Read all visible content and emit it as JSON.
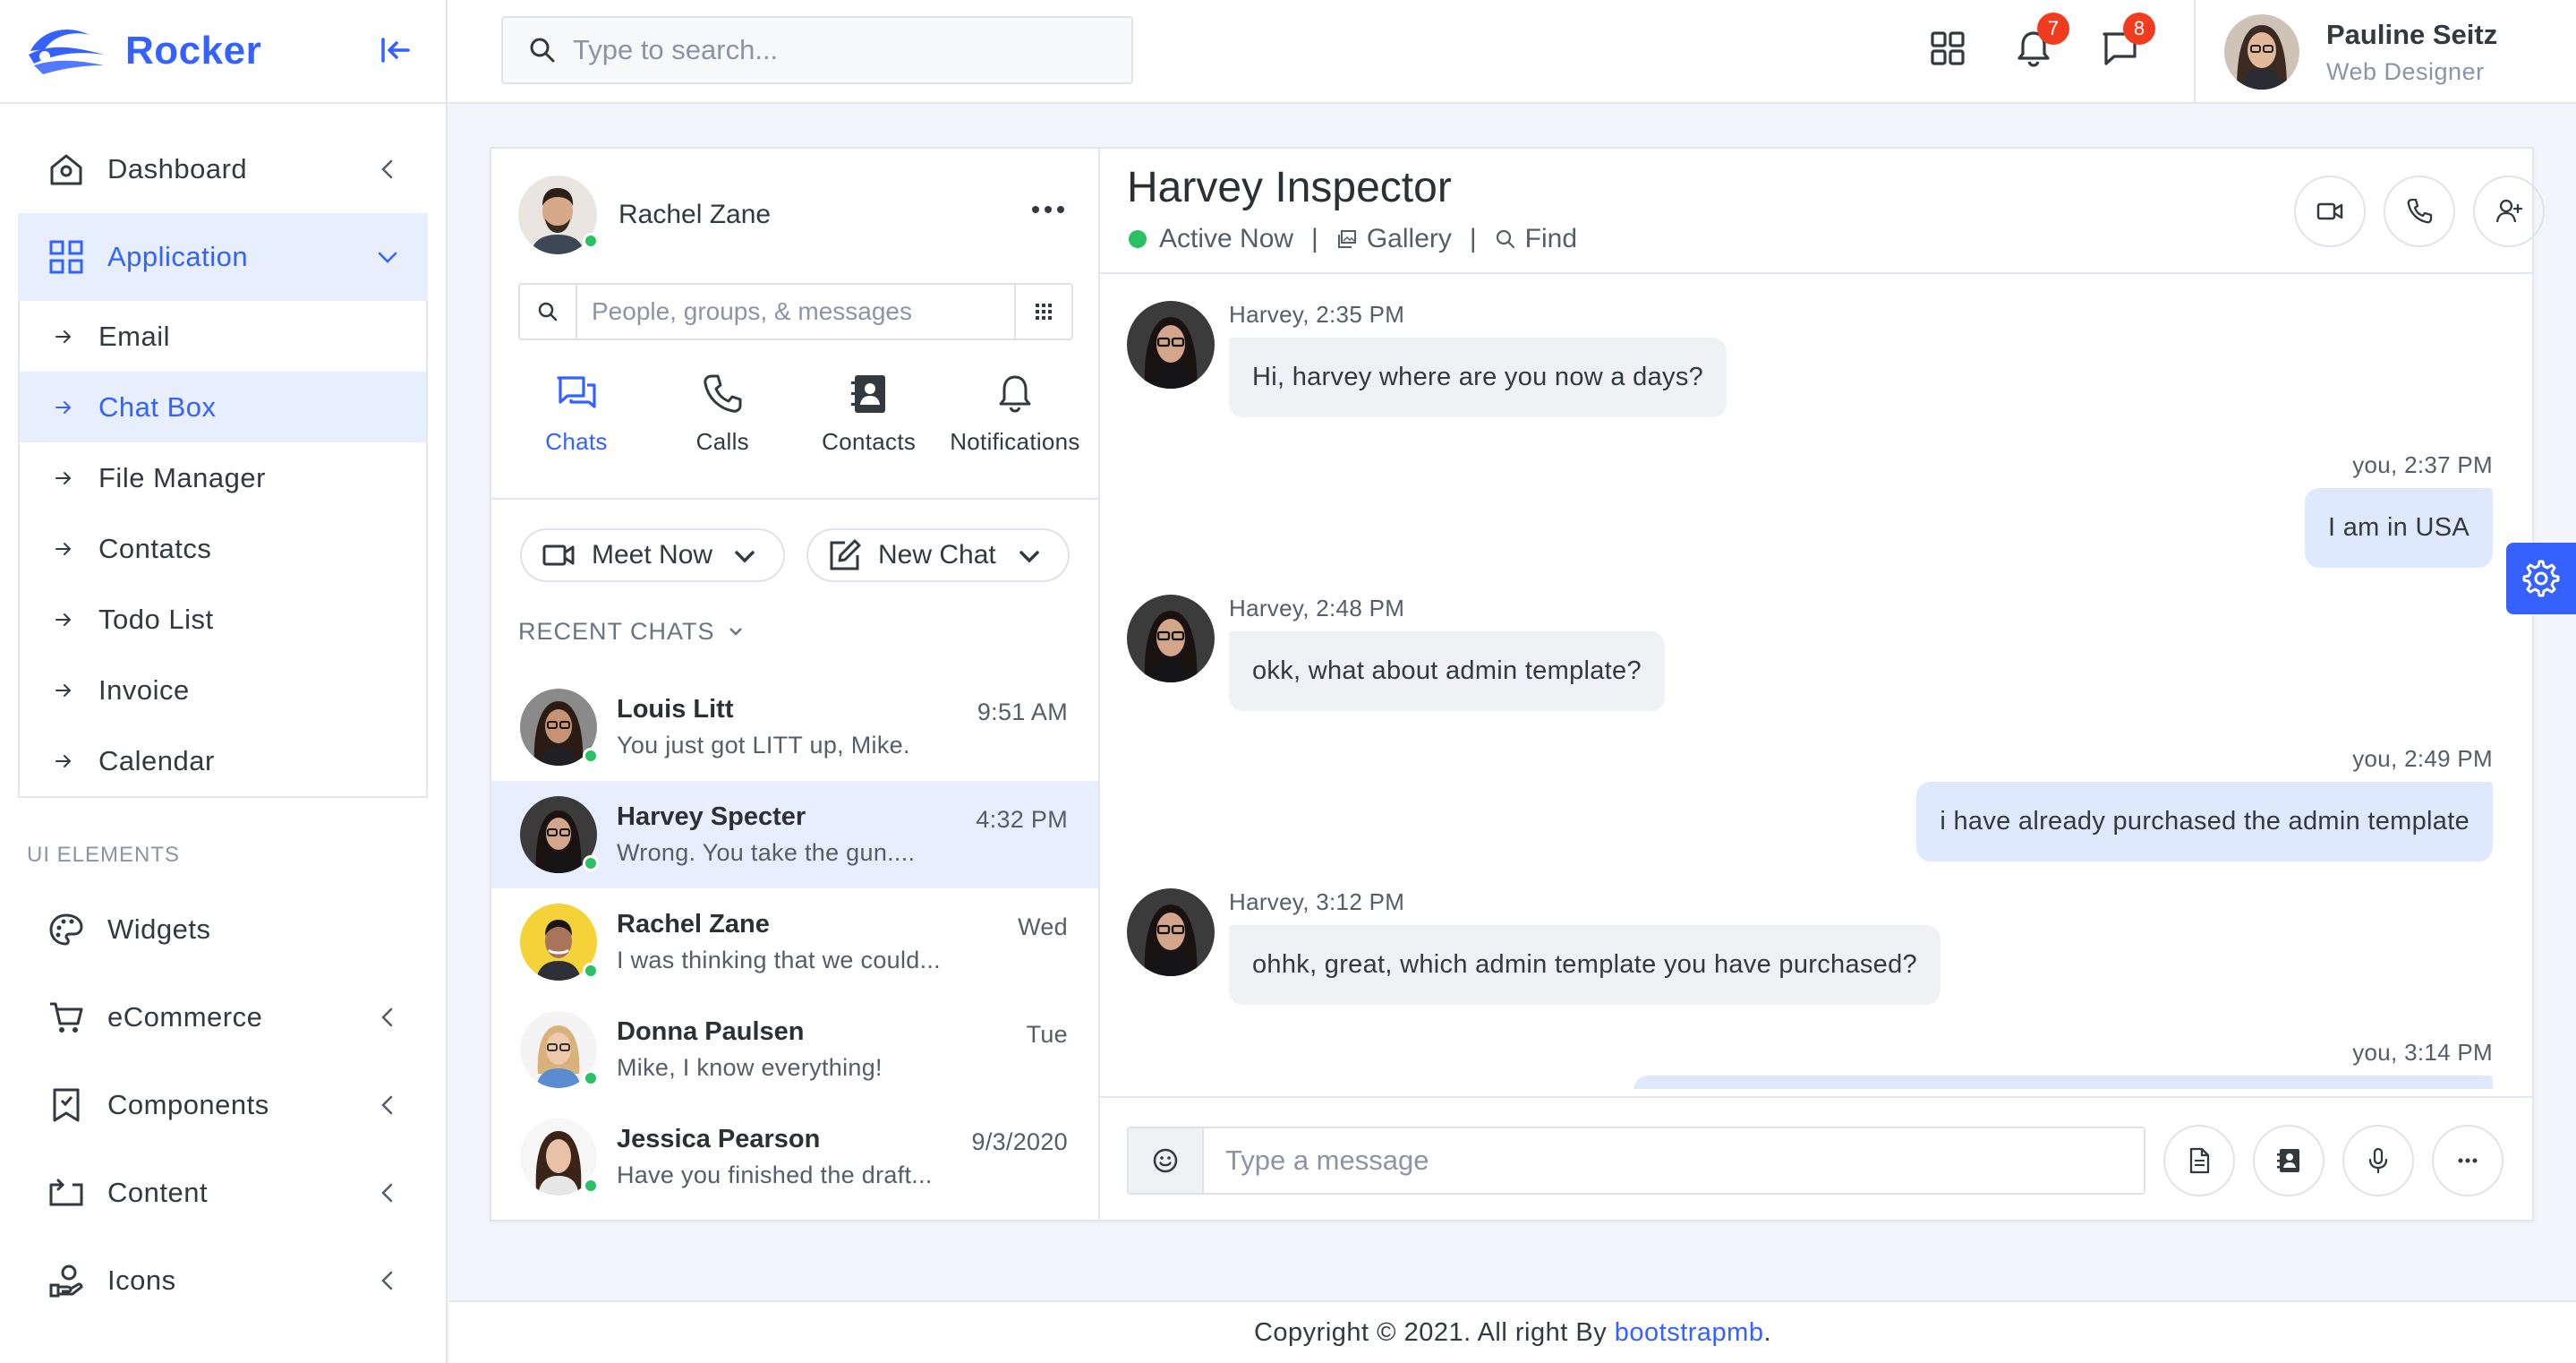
{
  "brand": {
    "name": "Rocker",
    "accent": "#3461ff"
  },
  "sidebar": {
    "items": [
      {
        "label": "Dashboard",
        "icon": "home-icon"
      },
      {
        "label": "Application",
        "icon": "grid-icon",
        "expanded": true
      },
      {
        "label": "Widgets",
        "icon": "palette-icon"
      },
      {
        "label": "eCommerce",
        "icon": "cart-icon"
      },
      {
        "label": "Components",
        "icon": "bookmark-icon"
      },
      {
        "label": "Content",
        "icon": "repeat-icon"
      },
      {
        "label": "Icons",
        "icon": "hand-icon"
      }
    ],
    "submenu": [
      "Email",
      "Chat Box",
      "File Manager",
      "Contatcs",
      "Todo List",
      "Invoice",
      "Calendar"
    ],
    "submenu_active": "Chat Box",
    "section_label": "UI ELEMENTS"
  },
  "topbar": {
    "search_placeholder": "Type to search...",
    "notification_count": "7",
    "message_count": "8",
    "user_name": "Pauline Seitz",
    "user_role": "Web Designer"
  },
  "chat_sidebar": {
    "me_name": "Rachel Zane",
    "search_placeholder": "People, groups, & messages",
    "tabs": [
      "Chats",
      "Calls",
      "Contacts",
      "Notifications"
    ],
    "active_tab": "Chats",
    "meet_now": "Meet Now",
    "new_chat": "New Chat",
    "recent_label": "RECENT CHATS",
    "chats": [
      {
        "name": "Louis Litt",
        "message": "You just got LITT up, Mike.",
        "time": "9:51 AM"
      },
      {
        "name": "Harvey Specter",
        "message": "Wrong. You take the gun....",
        "time": "4:32 PM",
        "active": true
      },
      {
        "name": "Rachel Zane",
        "message": "I was thinking that we could...",
        "time": "Wed"
      },
      {
        "name": "Donna Paulsen",
        "message": "Mike, I know everything!",
        "time": "Tue"
      },
      {
        "name": "Jessica Pearson",
        "message": "Have you finished the draft...",
        "time": "9/3/2020"
      }
    ]
  },
  "conversation": {
    "title": "Harvey Inspector",
    "status": "Active Now",
    "gallery": "Gallery",
    "find": "Find",
    "separator": "|",
    "messages": [
      {
        "from": "in",
        "meta": "Harvey, 2:35 PM",
        "text": "Hi, harvey where are you now a days?"
      },
      {
        "from": "out",
        "meta": "you, 2:37 PM",
        "text": "I am in USA"
      },
      {
        "from": "in",
        "meta": "Harvey, 2:48 PM",
        "text": "okk, what about admin template?"
      },
      {
        "from": "out",
        "meta": "you, 2:49 PM",
        "text": "i have already purchased the admin template"
      },
      {
        "from": "in",
        "meta": "Harvey, 3:12 PM",
        "text": "ohhk, great, which admin template you have purchased?"
      },
      {
        "from": "out",
        "meta": "you, 3:14 PM",
        "text": ""
      }
    ],
    "composer_placeholder": "Type a message"
  },
  "footer": {
    "text": "Copyright © 2021. All right By ",
    "link": "bootstrapmb",
    "end": "."
  }
}
